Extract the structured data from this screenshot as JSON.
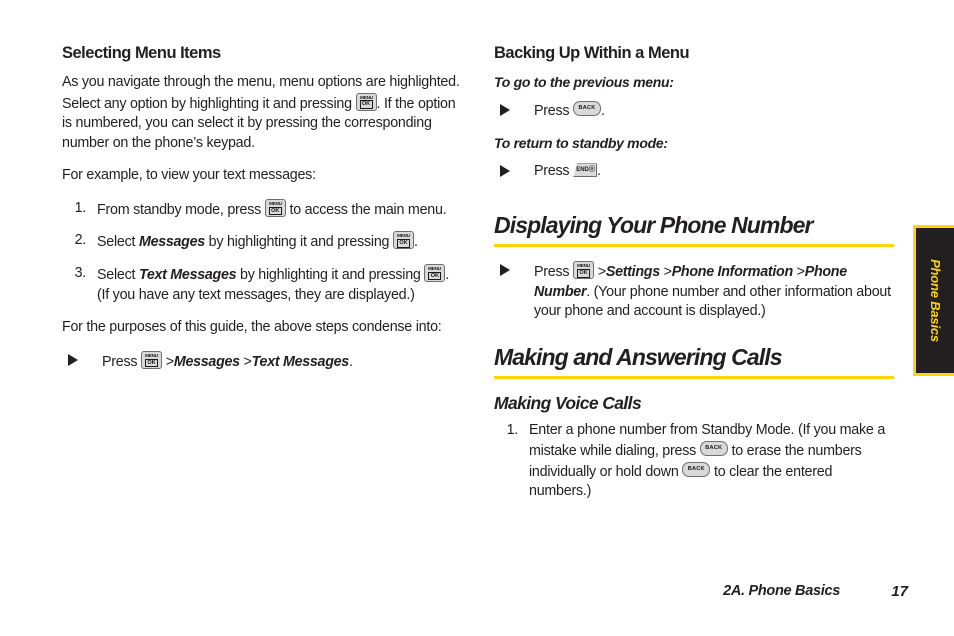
{
  "document": {
    "type": "phone-user-guide-page",
    "page_number": "17",
    "chapter_footer": "2A. Phone Basics",
    "thumb_tab_label": "Phone Basics",
    "accent_color": "#fcd407",
    "text_color": "#231f20",
    "tab_background": "#231f20"
  },
  "left_column": {
    "heading": "Selecting Menu Items",
    "paragraph_1_part_1": "As you navigate through the menu, menu options are highlighted. Select any option by highlighting it and pressing ",
    "paragraph_1_part_2": ". If the option is numbered, you can select it by pressing the corresponding number on the phone’s keypad.",
    "paragraph_2": "For example, to view your text messages:",
    "steps": [
      {
        "number": "1.",
        "text_before_key": "From standby mode, press ",
        "key": "menu-ok",
        "text_after_key": " to access the main menu."
      },
      {
        "number": "2.",
        "text_before_italic": "Select ",
        "italic": "Messages",
        "text_middle": " by highlighting it and pressing ",
        "key": "menu-ok",
        "text_after_key": "."
      },
      {
        "number": "3.",
        "text_before_italic": "Select ",
        "italic": "Text Messages",
        "text_middle": " by highlighting it and pressing ",
        "key": "menu-ok",
        "text_after_key": ".",
        "extra_line": "(If you have any text messages, they are displayed.)"
      }
    ],
    "paragraph_3": "For the purposes of this guide, the above steps condense into:",
    "condensed_bullet": {
      "text_before_key": "Press ",
      "key": "menu-ok",
      "separator_1": " >",
      "italic_1": "Messages",
      "separator_2": " >",
      "italic_2": "Text Messages",
      "trailing": "."
    }
  },
  "right_column": {
    "heading_backing_up": "Backing Up Within a Menu",
    "lead_in_previous_menu": "To go to the previous menu:",
    "bullet_previous_menu": {
      "text_before_key": "Press ",
      "key": "back",
      "text_after_key": "."
    },
    "lead_in_standby": "To return to standby mode:",
    "bullet_standby": {
      "text_before_key": "Press ",
      "key": "end",
      "text_after_key": "."
    },
    "section_displaying": "Displaying Your Phone Number",
    "bullet_displaying": {
      "text_before_key": "Press ",
      "key": "menu-ok",
      "separator_1": " >",
      "italic_1": "Settings",
      "separator_2": " >",
      "italic_2": "Phone Information",
      "separator_3": " >",
      "italic_3": "Phone Number",
      "trailing": ". (Your phone number and other information about your phone and account is displayed.)"
    },
    "section_making_answering": "Making and Answering Calls",
    "subsection_making_voice": "Making Voice Calls",
    "voice_steps": [
      {
        "number": "1.",
        "part_1": "Enter a phone number from Standby Mode. (If you make a mistake while dialing, press ",
        "key_1": "back",
        "part_2": " to erase the numbers individually or hold down ",
        "key_2": "back",
        "part_3": " to clear the entered numbers.)"
      }
    ]
  },
  "keys": {
    "menu_ok": {
      "top_label": "MENU",
      "bottom_label": "OK",
      "name": "menu-ok-key-icon"
    },
    "back": {
      "label": "BACK",
      "name": "back-key-icon"
    },
    "end": {
      "label": "ENDⓞ",
      "name": "end-key-icon"
    }
  }
}
